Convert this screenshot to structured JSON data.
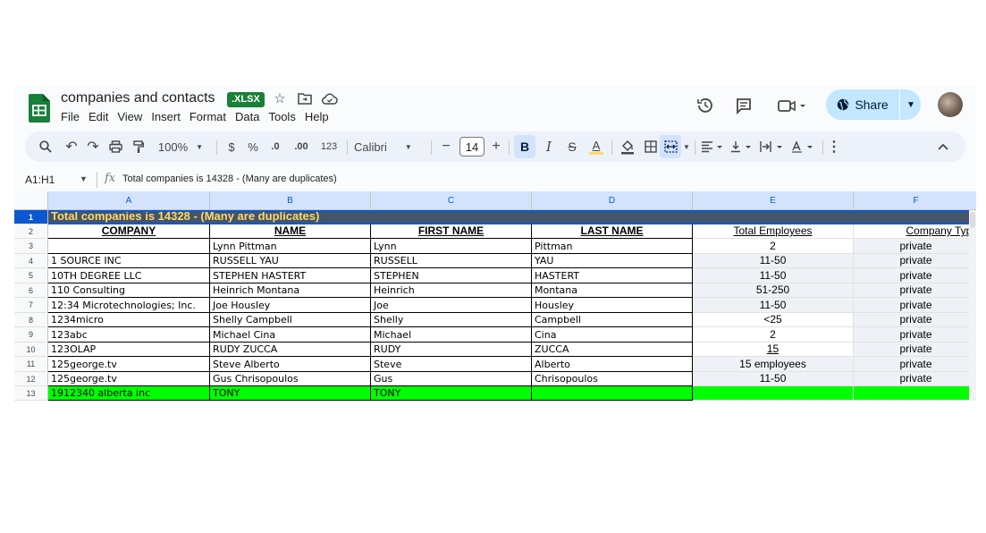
{
  "header": {
    "title": "companies and contacts",
    "file_badge": ".XLSX",
    "share_label": "Share",
    "brand_color": "#188038",
    "share_bg": "#c2e7ff"
  },
  "menu": [
    "File",
    "Edit",
    "View",
    "Insert",
    "Format",
    "Data",
    "Tools",
    "Help"
  ],
  "toolbar": {
    "zoom": "100%",
    "currency": "$",
    "percent": "%",
    "dec_decrease": ".0",
    "dec_increase": ".00",
    "number_format": "123",
    "font": "Calibri",
    "font_size": "14",
    "bold": "B",
    "italic": "I",
    "text_color": "A",
    "text_color_value": "#ffd966"
  },
  "formula_bar": {
    "name_box": "A1:H1",
    "fx": "fx",
    "formula": "Total companies is 14328 - (Many are duplicates)"
  },
  "grid": {
    "columns": [
      "A",
      "B",
      "C",
      "D",
      "E",
      "F"
    ],
    "row_numbers": [
      "1",
      "2",
      "3",
      "4",
      "5",
      "6",
      "7",
      "8",
      "9",
      "10",
      "11",
      "12",
      "13"
    ],
    "title_row": "Total companies is 14328 - (Many are duplicates)",
    "headers": [
      "COMPANY",
      "NAME",
      "FIRST NAME",
      "LAST NAME",
      "Total Employees",
      "Company Type"
    ],
    "rows": [
      [
        "",
        "Lynn Pittman",
        "Lynn",
        "Pittman",
        "2",
        "private"
      ],
      [
        "1 SOURCE INC",
        "RUSSELL YAU",
        "RUSSELL",
        "YAU",
        "11-50",
        "private"
      ],
      [
        "10TH DEGREE LLC",
        "STEPHEN HASTERT",
        "STEPHEN",
        "HASTERT",
        "11-50",
        "private"
      ],
      [
        "110 Consulting",
        "Heinrich Montana",
        "Heinrich",
        "Montana",
        "51-250",
        "private"
      ],
      [
        "12:34 Microtechnologies; Inc.",
        "Joe Housley",
        "Joe",
        "Housley",
        "11-50",
        "private"
      ],
      [
        "1234micro",
        "Shelly Campbell",
        "Shelly",
        "Campbell",
        "<25",
        "private"
      ],
      [
        "123abc",
        "Michael Cina",
        "Michael",
        "Cina",
        "2",
        "private"
      ],
      [
        "123OLAP",
        "RUDY ZUCCA",
        "RUDY",
        "ZUCCA",
        "15",
        "private"
      ],
      [
        "125george.tv",
        "Steve Alberto",
        "Steve",
        "Alberto",
        "15 employees",
        "private"
      ],
      [
        "125george.tv",
        "Gus Chrisopoulos",
        "Gus",
        "Chrisopoulos",
        "11-50",
        "private"
      ],
      [
        "1912340 alberta inc",
        "TONY",
        "TONY",
        "",
        "",
        ""
      ]
    ],
    "title_bg": "#44546a",
    "highlight_row_color": "#00ff00"
  }
}
